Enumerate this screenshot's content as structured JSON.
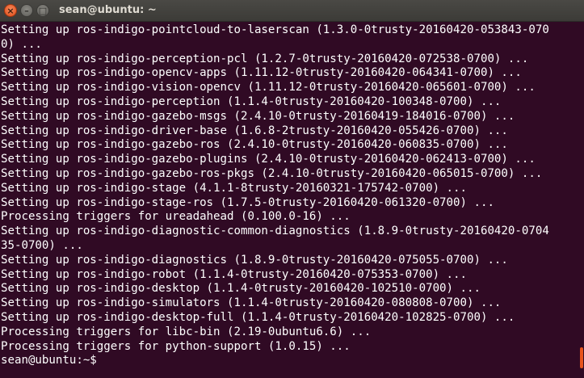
{
  "window": {
    "title": "sean@ubuntu: ~",
    "close_glyph": "×",
    "minimize_glyph": "–",
    "maximize_glyph": "□"
  },
  "terminal": {
    "lines": [
      "Setting up ros-indigo-pointcloud-to-laserscan (1.3.0-0trusty-20160420-053843-070",
      "0) ...",
      "Setting up ros-indigo-perception-pcl (1.2.7-0trusty-20160420-072538-0700) ...",
      "Setting up ros-indigo-opencv-apps (1.11.12-0trusty-20160420-064341-0700) ...",
      "Setting up ros-indigo-vision-opencv (1.11.12-0trusty-20160420-065601-0700) ...",
      "Setting up ros-indigo-perception (1.1.4-0trusty-20160420-100348-0700) ...",
      "Setting up ros-indigo-gazebo-msgs (2.4.10-0trusty-20160419-184016-0700) ...",
      "Setting up ros-indigo-driver-base (1.6.8-2trusty-20160420-055426-0700) ...",
      "Setting up ros-indigo-gazebo-ros (2.4.10-0trusty-20160420-060835-0700) ...",
      "Setting up ros-indigo-gazebo-plugins (2.4.10-0trusty-20160420-062413-0700) ...",
      "Setting up ros-indigo-gazebo-ros-pkgs (2.4.10-0trusty-20160420-065015-0700) ...",
      "Setting up ros-indigo-stage (4.1.1-8trusty-20160321-175742-0700) ...",
      "Setting up ros-indigo-stage-ros (1.7.5-0trusty-20160420-061320-0700) ...",
      "Processing triggers for ureadahead (0.100.0-16) ...",
      "Setting up ros-indigo-diagnostic-common-diagnostics (1.8.9-0trusty-20160420-0704",
      "35-0700) ...",
      "Setting up ros-indigo-diagnostics (1.8.9-0trusty-20160420-075055-0700) ...",
      "Setting up ros-indigo-robot (1.1.4-0trusty-20160420-075353-0700) ...",
      "Setting up ros-indigo-desktop (1.1.4-0trusty-20160420-102510-0700) ...",
      "Setting up ros-indigo-simulators (1.1.4-0trusty-20160420-080808-0700) ...",
      "Setting up ros-indigo-desktop-full (1.1.4-0trusty-20160420-102825-0700) ...",
      "Processing triggers for libc-bin (2.19-0ubuntu6.6) ...",
      "Processing triggers for python-support (1.0.15) ..."
    ],
    "prompt": "sean@ubuntu:~$ "
  },
  "colors": {
    "background": "#300a24",
    "text": "#ffffff",
    "close_button": "#df4a16",
    "scroll_thumb": "#e9541d"
  }
}
